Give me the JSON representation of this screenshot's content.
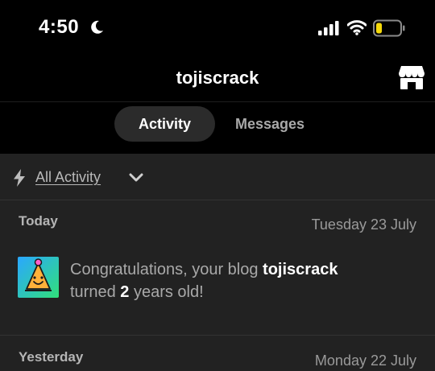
{
  "status_bar": {
    "time": "4:50",
    "battery_level": 0.25,
    "battery_color": "#f5d90a"
  },
  "header": {
    "blog_name": "tojiscrack"
  },
  "tabs": [
    {
      "label": "Activity",
      "active": true
    },
    {
      "label": "Messages",
      "active": false
    }
  ],
  "filter": {
    "label": "All Activity"
  },
  "sections": {
    "today": {
      "label": "Today",
      "date": "Tuesday 23 July"
    },
    "yesterday": {
      "label": "Yesterday",
      "date": "Monday 22 July"
    }
  },
  "notification": {
    "prefix": "Congratulations, your blog ",
    "blog": "tojiscrack",
    "mid": "turned ",
    "years": "2",
    "suffix": " years old!"
  },
  "colors": {
    "background": "#000000",
    "panel": "#222222",
    "tab_active_bg": "#2b2b2b",
    "avatar_gradient_start": "#2aa7ff",
    "avatar_gradient_end": "#31e07a"
  }
}
